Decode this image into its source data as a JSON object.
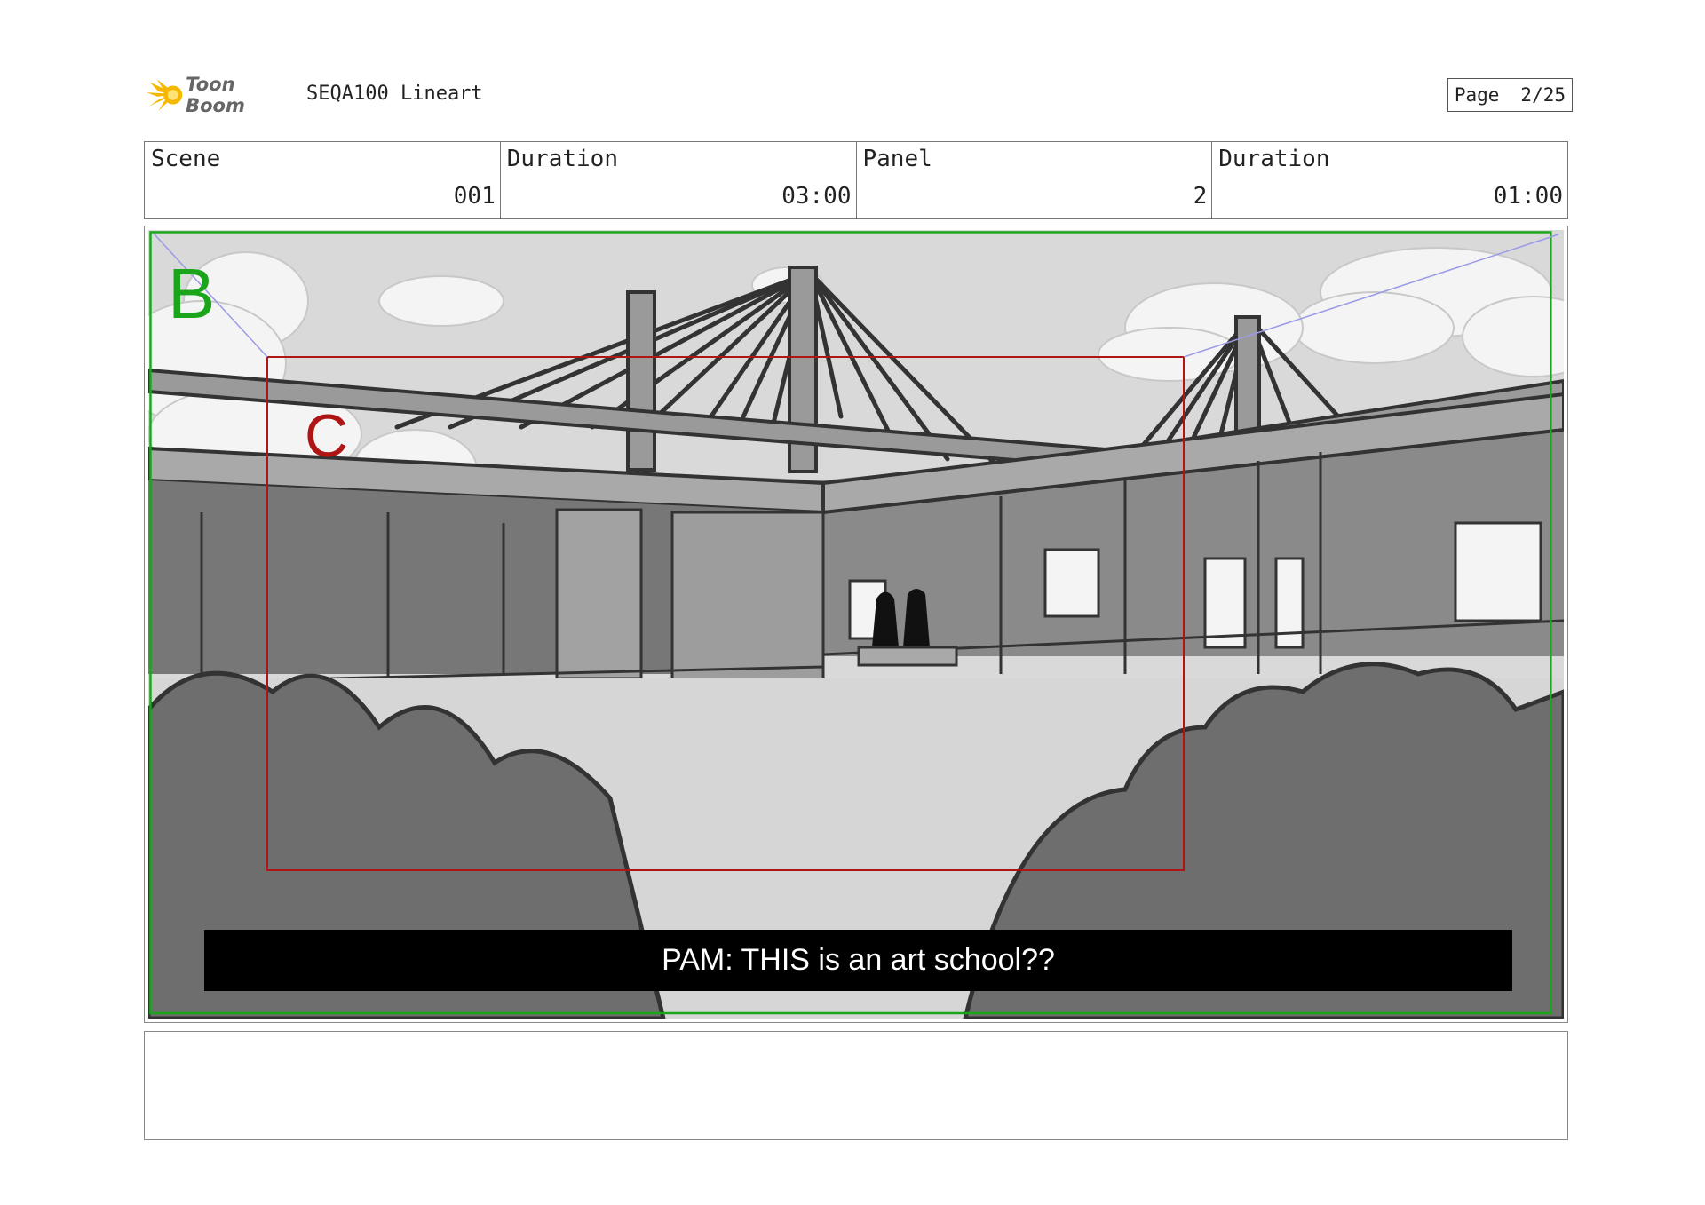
{
  "header": {
    "brand": "Toon Boom",
    "project_title": "SEQA100 Lineart",
    "page_label": "Page",
    "page_number": "2/25"
  },
  "info": {
    "scene_label": "Scene",
    "scene_value": "001",
    "scene_duration_label": "Duration",
    "scene_duration_value": "03:00",
    "panel_label": "Panel",
    "panel_value": "2",
    "panel_duration_label": "Duration",
    "panel_duration_value": "01:00"
  },
  "panel": {
    "caption": "PAM: THIS is an art school??",
    "field_b_label": "B",
    "field_c_label": "C",
    "colors": {
      "field_b": "#1aa51a",
      "field_c": "#b01515",
      "camera_move": "#9a9ae6"
    }
  },
  "notes": {
    "text": ""
  }
}
